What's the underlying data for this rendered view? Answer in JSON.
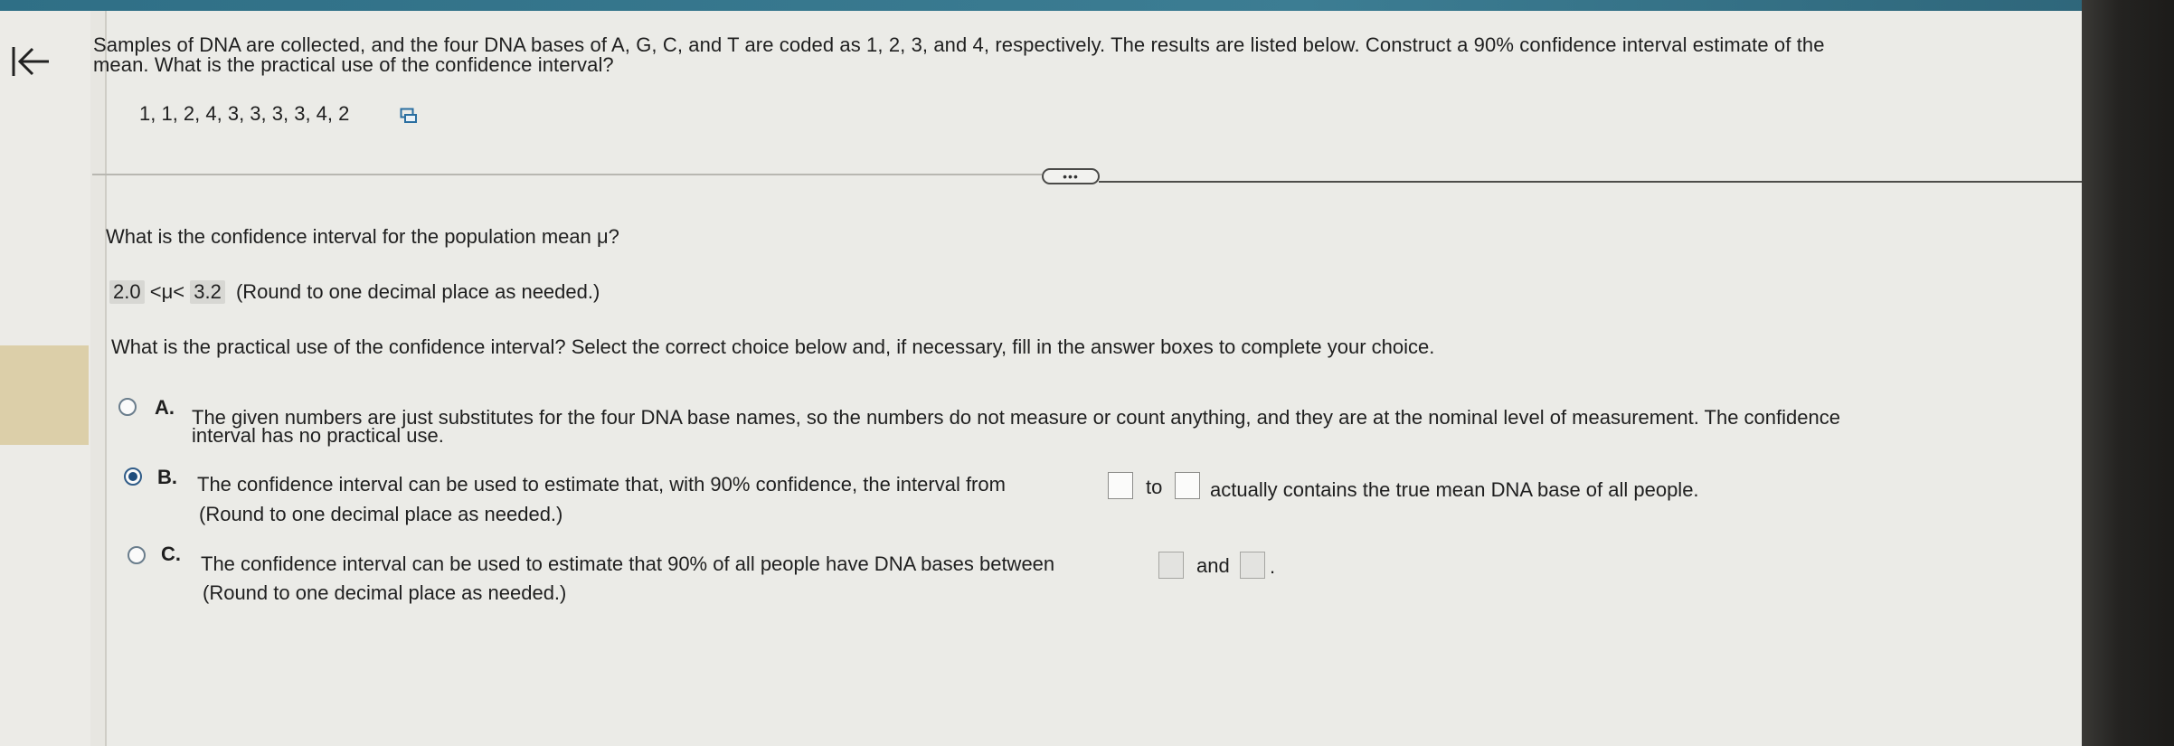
{
  "question": {
    "line1": "Samples of DNA are collected, and the four DNA bases of A, G, C, and T are coded as 1, 2, 3, and 4, respectively. The results are listed below. Construct a 90% confidence interval estimate of the",
    "line2": "mean. What is the practical use of the confidence interval?",
    "data_values": "1, 1, 2, 4, 3, 3, 3, 3, 4, 2"
  },
  "more_button_label": "•••",
  "part1": {
    "prompt": "What is the confidence interval for the population mean μ?",
    "lower": "2.0",
    "mid": "<μ<",
    "upper": "3.2",
    "hint": "(Round to one decimal place as needed.)"
  },
  "part2": {
    "prompt": "What is the practical use of the confidence interval? Select the correct choice below and, if necessary, fill in the answer boxes to complete your choice."
  },
  "choices": {
    "a": {
      "letter": "A.",
      "line1": "The given numbers are just substitutes for the four DNA base names, so the numbers do not measure or count anything, and they are at the nominal level of measurement. The confidence",
      "line2": "interval has no practical use.",
      "selected": false
    },
    "b": {
      "letter": "B.",
      "text_before": "The confidence interval can be used to estimate that, with 90% confidence, the interval from",
      "text_between": "to",
      "text_after": "actually contains the true mean DNA base of all people.",
      "hint": "(Round to one decimal place as needed.)",
      "selected": true
    },
    "c": {
      "letter": "C.",
      "text_before": "The confidence interval can be used to estimate that 90% of all people have DNA bases between",
      "text_between": "and",
      "text_after": ".",
      "hint": "(Round to one decimal place as needed.)",
      "selected": false
    }
  },
  "colors": {
    "page_bg": "#ebebe7",
    "accent_strip": "#3c7d93",
    "radio_selected": "#1f4d7d"
  }
}
